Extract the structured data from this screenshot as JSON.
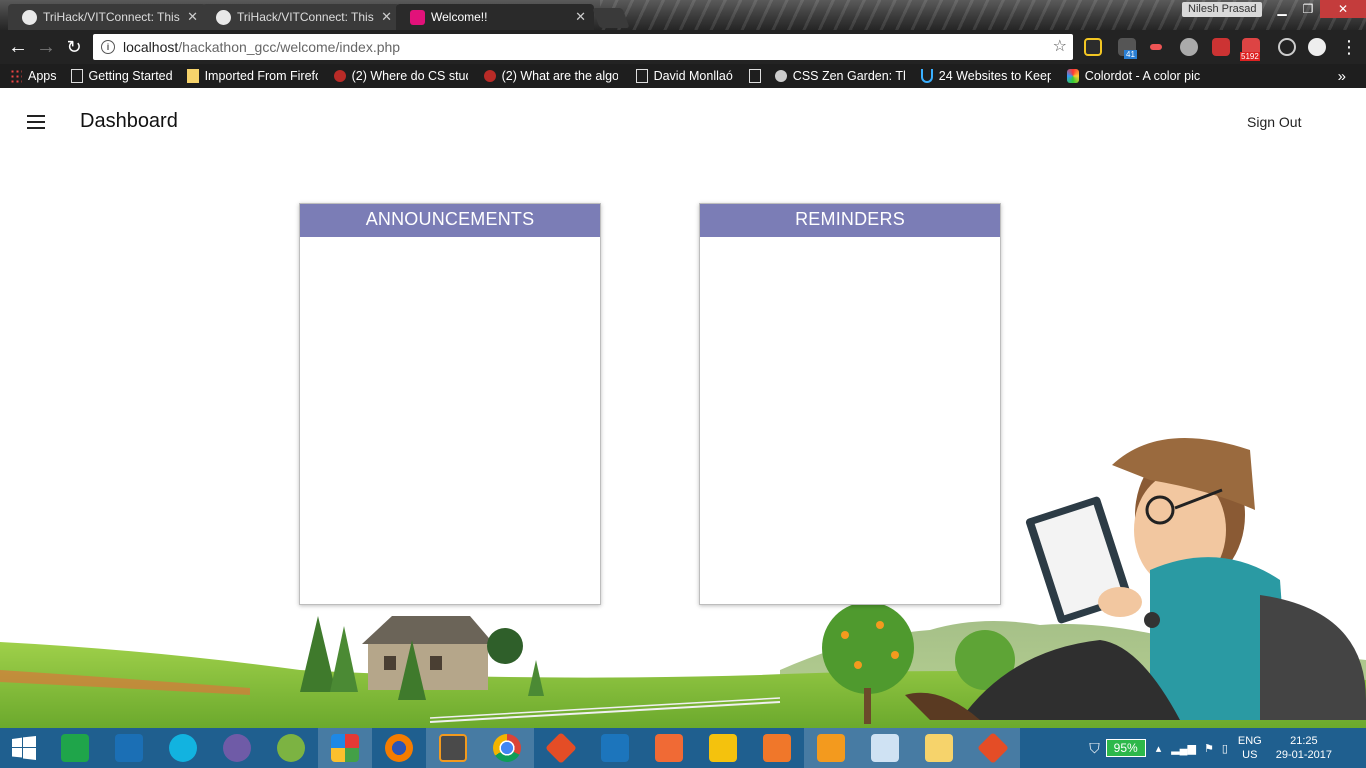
{
  "browser": {
    "tabs": [
      {
        "title": "TriHack/VITConnect: This",
        "icon": "github-icon",
        "active": false
      },
      {
        "title": "TriHack/VITConnect: This",
        "icon": "github-icon",
        "active": false
      },
      {
        "title": "Welcome!!",
        "icon": "site-favicon",
        "active": true
      }
    ],
    "profile_name": "Nilesh Prasad",
    "url_host": "localhost",
    "url_path": "/hackathon_gcc/welcome/index.php",
    "bookmarks": [
      {
        "label": "Apps",
        "icon": "apps-grid-icon"
      },
      {
        "label": "Getting Started",
        "icon": "page-icon"
      },
      {
        "label": "Imported From Firefo",
        "icon": "folder-icon"
      },
      {
        "label": "(2) Where do CS stud",
        "icon": "quora-icon"
      },
      {
        "label": "(2) What are the algo",
        "icon": "quora-icon"
      },
      {
        "label": "David Monllaó",
        "icon": "page-icon"
      },
      {
        "label": "CSS Zen Garden: The",
        "icon": "github-icon"
      },
      {
        "label": "24 Websites to Keep",
        "icon": "udacity-icon"
      },
      {
        "label": "Colordot - A color pic",
        "icon": "colordot-icon"
      }
    ],
    "ext_badges": {
      "badge_41": "41",
      "mail_count": "5192"
    }
  },
  "app": {
    "title": "Dashboard",
    "sign_out": "Sign Out"
  },
  "cards": {
    "announcements": {
      "title": "ANNOUNCEMENTS"
    },
    "reminders": {
      "title": "REMINDERS"
    }
  },
  "taskbar": {
    "battery": "95%",
    "lang_top": "ENG",
    "lang_bottom": "US",
    "time": "21:25",
    "date": "29-01-2017"
  },
  "colors": {
    "card_header": "#7b7db6",
    "taskbar": "#1f5f8f"
  }
}
